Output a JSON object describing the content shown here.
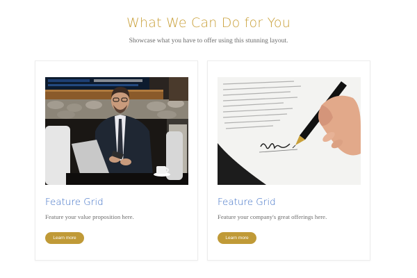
{
  "section": {
    "title": "What We Can Do for You",
    "subtitle": "Showcase what you have to offer using this stunning layout."
  },
  "cards": [
    {
      "image_alt": "businessman-with-laptop-photo",
      "title": "Feature Grid",
      "text": "Feature your value proposition here.",
      "button_label": "Learn more"
    },
    {
      "image_alt": "hand-signing-document-photo",
      "title": "Feature Grid",
      "text": "Feature your company's great offerings here.",
      "button_label": "Learn more"
    }
  ],
  "colors": {
    "accent_gold": "#c9a03a",
    "button_gold": "#c09a37",
    "title_blue": "#3d6fc6",
    "body_text": "#6d6d6d"
  }
}
